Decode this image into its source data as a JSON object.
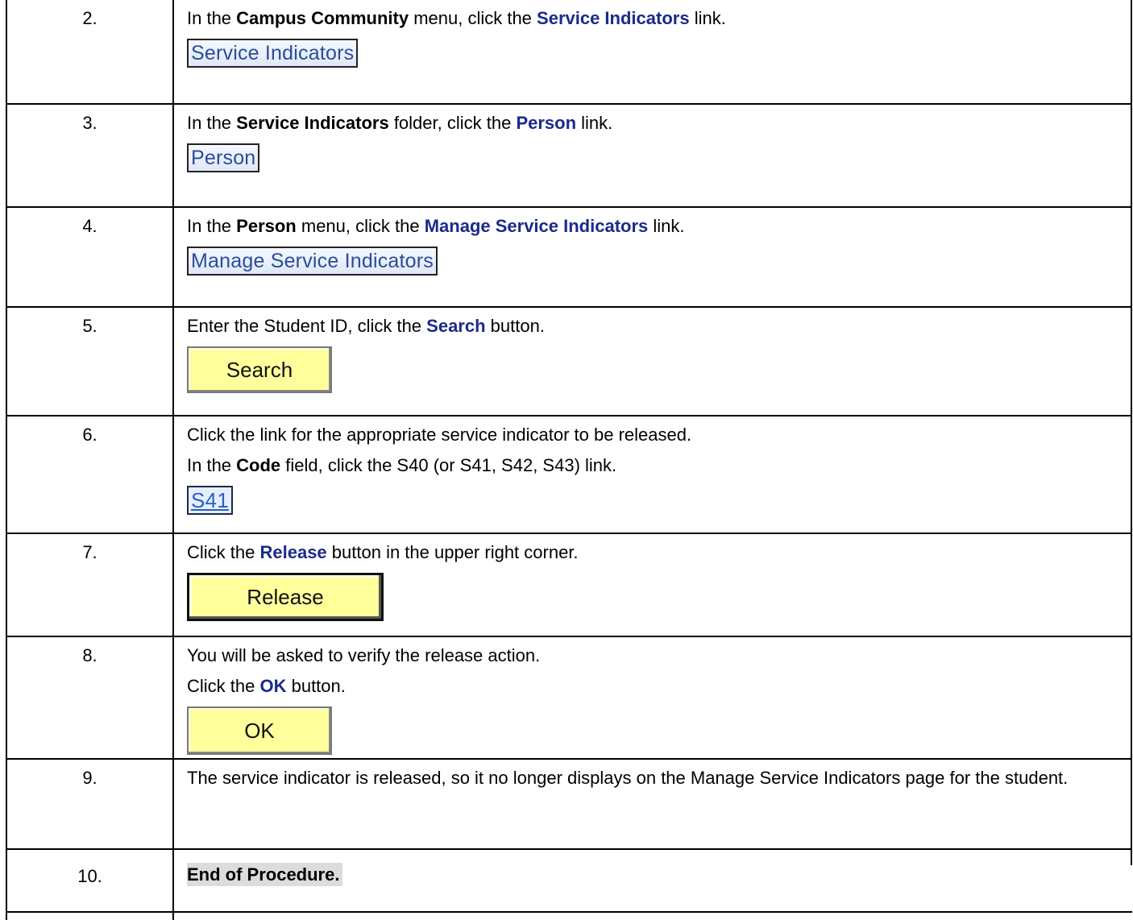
{
  "steps": [
    {
      "num": "2.",
      "t1": "In the ",
      "b1": "Campus Community",
      "t2": " menu, click the ",
      "l1": "Service Indicators",
      "t3": " link.",
      "capture": "Service Indicators"
    },
    {
      "num": "3.",
      "t1": "In the ",
      "b1": "Service Indicators",
      "t2": " folder, click the ",
      "l1": "Person",
      "t3": " link.",
      "capture": "Person"
    },
    {
      "num": "4.",
      "t1": "In the ",
      "b1": "Person",
      "t2": " menu, click the ",
      "l1": "Manage Service Indicators",
      "t3": " link.",
      "capture": "Manage Service Indicators"
    },
    {
      "num": "5.",
      "t1": "Enter the Student ID, click the ",
      "l1": "Search",
      "t2": " button.",
      "button": "Search"
    },
    {
      "num": "6.",
      "line1": "Click the link for the appropriate service indicator to be released.",
      "t1": "In the ",
      "b1": "Code",
      "t2": " field, click the S40 (or S41, S42, S43) link.",
      "capture": "S41"
    },
    {
      "num": "7.",
      "t1": "Click the ",
      "l1": "Release",
      "t2": " button in the upper right corner.",
      "button": "Release"
    },
    {
      "num": "8.",
      "line1": "You will be asked to verify the release action.",
      "t1": "Click the ",
      "l1": "OK",
      "t2": " button.",
      "button": "OK"
    },
    {
      "num": "9.",
      "text": "The service indicator is released, so it no longer displays on the Manage Service Indicators page for the student."
    },
    {
      "num": "10.",
      "text": "End of Procedure."
    }
  ]
}
